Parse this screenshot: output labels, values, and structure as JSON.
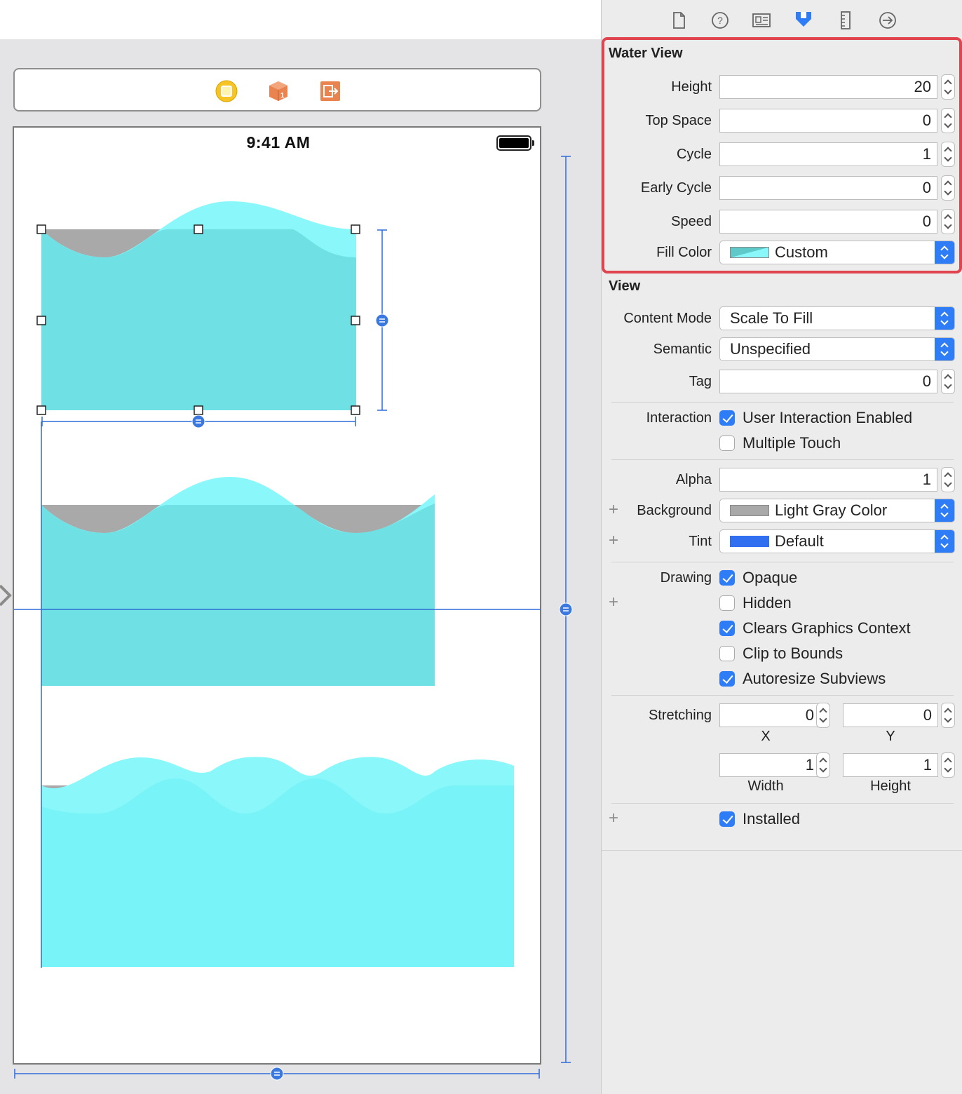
{
  "canvas": {
    "status_time": "9:41 AM",
    "dock_icons": [
      "view-controller-icon",
      "first-responder-icon",
      "exit-icon"
    ],
    "colors": {
      "water_front": "#6fe0e3",
      "water_back": "#8af8fb",
      "water_light": "#75f2f6",
      "gray_bg": "#a9a9a9",
      "guide": "#2f6bd8"
    }
  },
  "inspector": {
    "tabs": [
      "file-inspector-icon",
      "quick-help-icon",
      "identity-inspector-icon",
      "attributes-inspector-icon",
      "size-inspector-icon",
      "connections-inspector-icon"
    ],
    "water_view": {
      "title": "Water View",
      "fields": [
        {
          "label": "Height",
          "value": "20"
        },
        {
          "label": "Top Space",
          "value": "0"
        },
        {
          "label": "Cycle",
          "value": "1"
        },
        {
          "label": "Early Cycle",
          "value": "0"
        },
        {
          "label": "Speed",
          "value": "0"
        }
      ],
      "fill_color": {
        "label": "Fill Color",
        "value": "Custom",
        "swatch": "#5fc8c8"
      }
    },
    "view": {
      "title": "View",
      "content_mode": {
        "label": "Content Mode",
        "value": "Scale To Fill"
      },
      "semantic": {
        "label": "Semantic",
        "value": "Unspecified"
      },
      "tag": {
        "label": "Tag",
        "value": "0"
      },
      "interaction": {
        "label": "Interaction",
        "options": [
          {
            "label": "User Interaction Enabled",
            "checked": true
          },
          {
            "label": "Multiple Touch",
            "checked": false
          }
        ]
      },
      "alpha": {
        "label": "Alpha",
        "value": "1"
      },
      "background": {
        "label": "Background",
        "value": "Light Gray Color",
        "swatch": "#a9a9a9"
      },
      "tint": {
        "label": "Tint",
        "value": "Default",
        "swatch": "#2f6ff0"
      },
      "drawing": {
        "label": "Drawing",
        "options": [
          {
            "label": "Opaque",
            "checked": true
          },
          {
            "label": "Hidden",
            "checked": false
          },
          {
            "label": "Clears Graphics Context",
            "checked": true
          },
          {
            "label": "Clip to Bounds",
            "checked": false
          },
          {
            "label": "Autoresize Subviews",
            "checked": true
          }
        ]
      },
      "stretching": {
        "label": "Stretching",
        "x": "0",
        "y": "0",
        "width": "1",
        "height": "1",
        "x_caption": "X",
        "y_caption": "Y",
        "width_caption": "Width",
        "height_caption": "Height"
      },
      "installed": {
        "label": "Installed",
        "checked": true
      }
    }
  }
}
